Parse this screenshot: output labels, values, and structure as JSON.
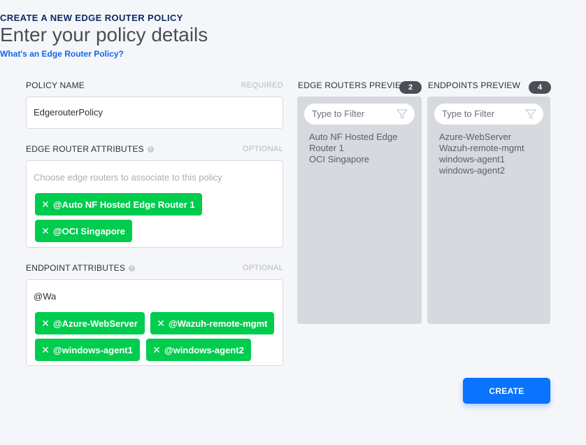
{
  "header": {
    "eyebrow": "CREATE A NEW EDGE ROUTER POLICY",
    "title": "Enter your policy details",
    "help_link": "What's an Edge Router Policy?"
  },
  "policy_name": {
    "label": "POLICY NAME",
    "hint": "REQUIRED",
    "value": "EdgerouterPolicy"
  },
  "edge_router_attributes": {
    "label": "EDGE ROUTER ATTRIBUTES",
    "hint": "OPTIONAL",
    "placeholder": "Choose edge routers to associate to this policy",
    "chips": [
      "@Auto NF Hosted Edge Router 1",
      "@OCI Singapore"
    ]
  },
  "endpoint_attributes": {
    "label": "ENDPOINT ATTRIBUTES",
    "hint": "OPTIONAL",
    "typed_value": "@Wa",
    "chips": [
      "@Azure-WebServer",
      "@Wazuh-remote-mgmt",
      "@windows-agent1",
      "@windows-agent2"
    ]
  },
  "edge_routers_preview": {
    "label": "EDGE ROUTERS PREVIEW",
    "count": "2",
    "filter_placeholder": "Type to Filter",
    "items": [
      "Auto NF Hosted Edge Router 1",
      "OCI Singapore"
    ]
  },
  "endpoints_preview": {
    "label": "ENDPOINTS PREVIEW",
    "count": "4",
    "filter_placeholder": "Type to Filter",
    "items": [
      "Azure-WebServer",
      "Wazuh-remote-mgmt",
      "windows-agent1",
      "windows-agent2"
    ]
  },
  "actions": {
    "create_label": "CREATE"
  },
  "icons": {
    "remove_chip": "close-icon",
    "filter": "funnel-icon",
    "info": "info-icon"
  },
  "colors": {
    "chip": "#00cc4e",
    "primary": "#0a73ff",
    "link": "#1567e8",
    "badge": "#4a4e57",
    "panel": "#d6d9de"
  }
}
